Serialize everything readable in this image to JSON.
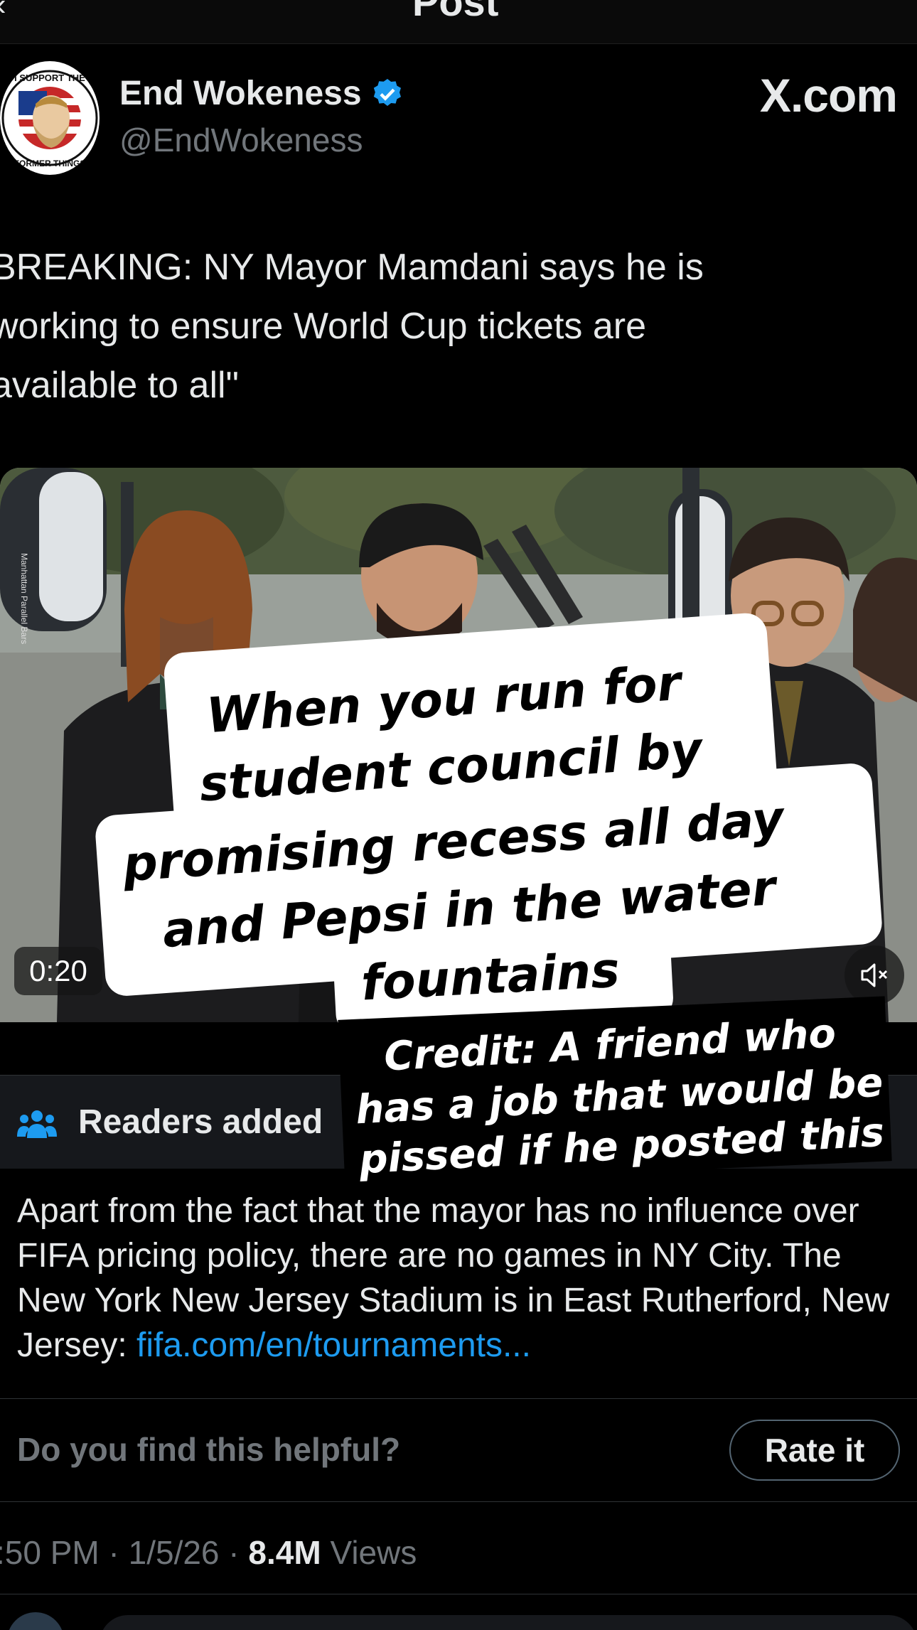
{
  "header": {
    "back_icon": "back-arrow-icon",
    "title": "Post"
  },
  "author": {
    "name": "End Wokeness",
    "handle": "@EndWokeness",
    "avatar_icon": "avatar-logo-icon",
    "avatar_text_top": "I SUPPORT THE",
    "avatar_text_bottom": "FORMER THINGS",
    "verified_icon": "verified-badge-icon",
    "verified_color": "#1d9bf0"
  },
  "watermark": "X.com",
  "tweet_lines": [
    "BREAKING: NY Mayor Mamdani says he is",
    "working to ensure World Cup tickets are",
    "available to all\""
  ],
  "video": {
    "time": "0:20",
    "mute_icon": "speaker-muted-icon",
    "sign_left": "Manhattan  Parallel Bars"
  },
  "meme": {
    "lines": [
      "When you run for",
      "student council by",
      "promising recess all day",
      "and Pepsi in the water",
      "fountains"
    ],
    "credit_lines": [
      "Credit: A friend who",
      "has a job that would be",
      "pissed if he posted this"
    ]
  },
  "notes": {
    "icon": "people-icon",
    "header": "Readers added",
    "body": "Apart from the fact that the mayor has no influence over FIFA pricing policy, there are no games in NY City. The New York New Jersey Stadium is in East Rutherford, New Jersey: ",
    "link": "fifa.com/en/tournaments...",
    "link_color": "#1d9bf0",
    "helpful_question": "Do you find this helpful?",
    "rate_button": "Rate it"
  },
  "meta": {
    "time": ":50 PM",
    "sep1": " · ",
    "date": "1/5/26",
    "sep2": " · ",
    "views_count": "8.4M",
    "views_label": " Views"
  }
}
